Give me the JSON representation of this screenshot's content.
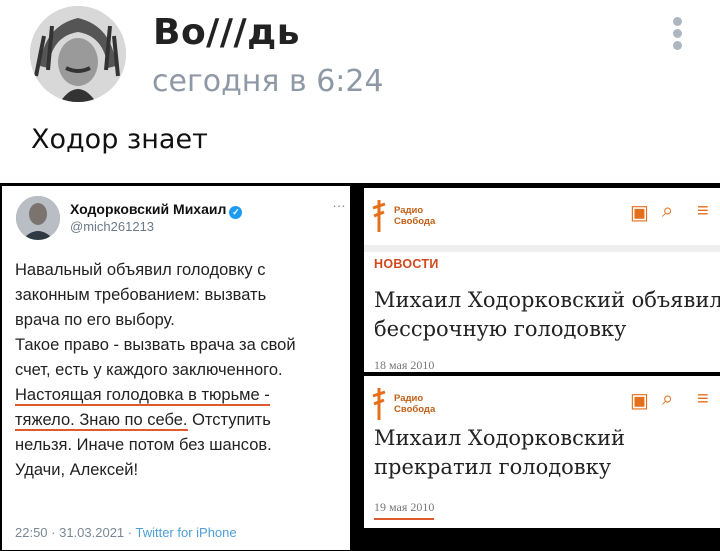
{
  "post": {
    "author": "Во///дь",
    "time": "сегодня в 6:24",
    "text": "Ходор знает"
  },
  "tweet": {
    "name": "Ходорковский Михаил",
    "handle": "@mich261213",
    "more": "…",
    "lines": [
      "Навальный объявил голодовку с",
      "законным требованием: вызвать",
      "врача по его выбору.",
      "Такое право - вызвать врача за свой",
      "счет, есть у каждого заключенного.",
      "Настоящая голодовка в тюрьме -",
      "тяжело. Знаю по себе.",
      " Отступить",
      "нельзя. Иначе потом без шансов.",
      "Удачи, Алексей!"
    ],
    "meta_time": "22:50 · 31.03.2021 · ",
    "meta_source": "Twitter for iPhone"
  },
  "articles": [
    {
      "logo_line1": "Радио",
      "logo_line2": "Свобода",
      "section": "НОВОСТИ",
      "headline_line1": "Михаил Ходорковский объявил",
      "headline_line2": "бессрочную голодовку",
      "date": "18 мая 2010"
    },
    {
      "logo_line1": "Радио",
      "logo_line2": "Свобода",
      "headline_line1": "Михаил Ходорковский",
      "headline_line2": "прекратил голодовку",
      "date": "19 мая 2010"
    }
  ],
  "icons": {
    "translate": "translate-icon",
    "search": "search-icon",
    "menu": "hamburger-icon"
  },
  "colors": {
    "accent": "#e4701c",
    "underline": "#e05a30",
    "time_gray": "#8f99a6",
    "twitter_blue": "#1d9bf0"
  }
}
